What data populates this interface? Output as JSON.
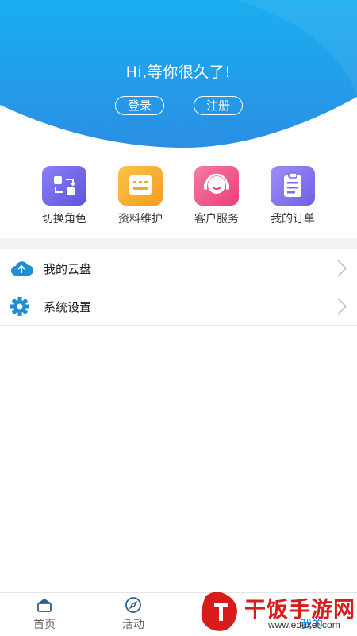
{
  "header": {
    "greeting": "Hi,等你很久了!",
    "login_label": "登录",
    "register_label": "注册",
    "colors": {
      "gradient_top": "#1da9ec",
      "gradient_bottom": "#2f8fe6"
    }
  },
  "quick_actions": [
    {
      "label": "切换角色",
      "icon": "switch-role-icon",
      "color": "#7a6ff0"
    },
    {
      "label": "资料维护",
      "icon": "profile-edit-icon",
      "color": "#f9b233"
    },
    {
      "label": "客户服务",
      "icon": "customer-service-icon",
      "color": "#f15b8d"
    },
    {
      "label": "我的订单",
      "icon": "order-clipboard-icon",
      "color": "#8c7cf3"
    }
  ],
  "menu": [
    {
      "label": "我的云盘",
      "icon": "cloud-upload-icon"
    },
    {
      "label": "系统设置",
      "icon": "gear-icon"
    }
  ],
  "tabbar": {
    "tabs": [
      {
        "label": "首页",
        "icon": "home-icon"
      },
      {
        "label": "活动",
        "icon": "compass-icon"
      },
      {
        "label": "",
        "icon": "discover-icon"
      },
      {
        "label": "我的",
        "icon": "profile-icon"
      }
    ]
  },
  "watermark": {
    "text": "干饭手游网",
    "url": "www.eduxet.com"
  }
}
